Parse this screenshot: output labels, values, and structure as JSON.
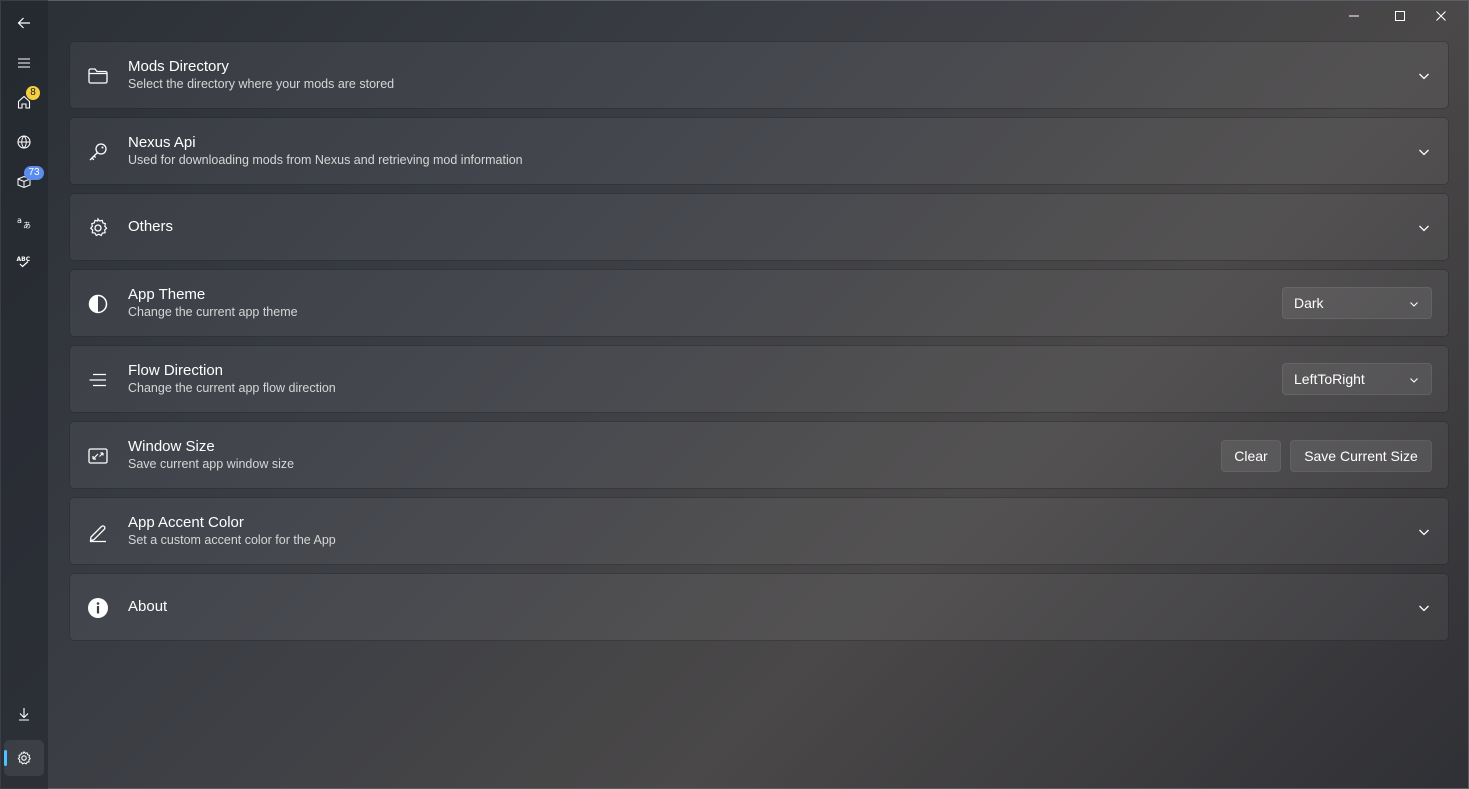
{
  "nav": {
    "items": [
      {
        "icon": "back-arrow-icon"
      },
      {
        "icon": "hamburger-menu-icon"
      },
      {
        "icon": "home-icon",
        "badge": "8"
      },
      {
        "icon": "globe-icon"
      },
      {
        "icon": "package-update-icon",
        "badge": "73"
      },
      {
        "icon": "translate-icon"
      },
      {
        "icon": "spellcheck-icon"
      },
      {
        "icon": "download-icon"
      },
      {
        "icon": "settings-icon",
        "selected": true
      }
    ]
  },
  "settings": {
    "mods_directory": {
      "title": "Mods Directory",
      "description": "Select the directory where your mods are stored",
      "icon": "folder-icon"
    },
    "nexus_api": {
      "title": "Nexus Api",
      "description": "Used for downloading mods from Nexus and retrieving mod information",
      "icon": "key-icon"
    },
    "others": {
      "title": "Others",
      "icon": "gear-icon"
    },
    "app_theme": {
      "title": "App Theme",
      "description": "Change the current app theme",
      "icon": "contrast-icon",
      "selected": "Dark"
    },
    "flow_direction": {
      "title": "Flow Direction",
      "description": "Change the current app flow direction",
      "icon": "align-lines-icon",
      "selected": "LeftToRight"
    },
    "window_size": {
      "title": "Window Size",
      "description": "Save current app window size",
      "icon": "resize-icon",
      "clear_label": "Clear",
      "save_label": "Save Current Size"
    },
    "accent_color": {
      "title": "App Accent Color",
      "description": "Set a custom accent color for the App",
      "icon": "pen-icon"
    },
    "about": {
      "title": "About",
      "icon": "info-icon"
    }
  },
  "colors": {
    "accent": "#4cc2ff",
    "badge_yellow": "#f4d03f",
    "badge_blue": "#5b8def"
  }
}
